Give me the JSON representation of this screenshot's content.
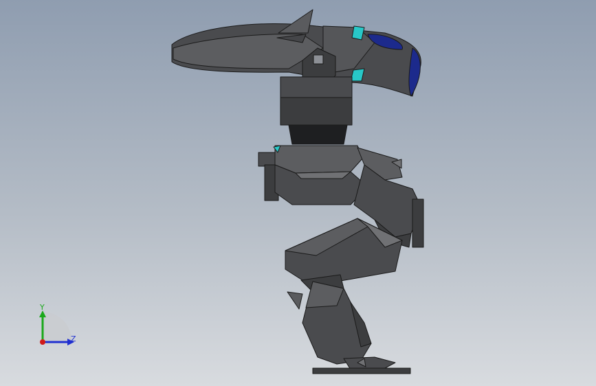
{
  "triad": {
    "y_label": "Y",
    "z_label": "Z",
    "colors": {
      "y": "#1aa81a",
      "z": "#1f2fd0",
      "x": "#d01a1a"
    }
  },
  "model": {
    "colors": {
      "body_dark": "#3c3d3f",
      "body_mid": "#4a4b4e",
      "body_light": "#5c5d60",
      "body_highlight": "#707174",
      "edge": "#1a1a1a",
      "accent_cyan": "#28c8c8",
      "visor_blue": "#1c2a8c"
    }
  }
}
